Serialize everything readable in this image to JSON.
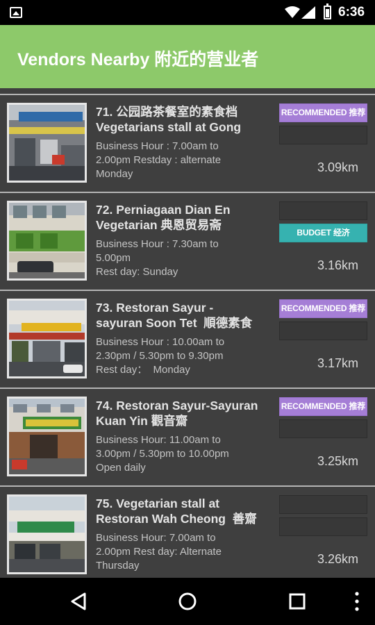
{
  "status_bar": {
    "time": "6:36"
  },
  "app_bar": {
    "title": "Vendors Nearby 附近的营业者"
  },
  "vendors": [
    {
      "name": "71. 公园路茶餐室的素食档\nVegetarians stall at Gong",
      "hours": "Business Hour : 7.00am to\n2.00pm Restday : alternate\nMonday",
      "badge1": "RECOMMENDED 推荐",
      "badge2": "",
      "distance": "3.09km"
    },
    {
      "name": "72. Perniagaan Dian En\nVegetarian 典恩贸易斋",
      "hours": "Business Hour : 7.30am to\n5.00pm\nRest day: Sunday",
      "badge1": "",
      "badge2": "BUDGET 经济",
      "distance": "3.16km"
    },
    {
      "name": "73. Restoran Sayur -\nsayuran Soon Tet  順德素食",
      "hours": "Business Hour : 10.00am to\n2.30pm / 5.30pm to 9.30pm\nRest day：  Monday",
      "badge1": "RECOMMENDED 推荐",
      "badge2": "",
      "distance": "3.17km"
    },
    {
      "name": "74. Restoran Sayur-Sayuran\nKuan Yin 觀音齋",
      "hours": "Business Hour: 11.00am to\n3.00pm / 5.30pm to 10.00pm\nOpen daily",
      "badge1": "RECOMMENDED 推荐",
      "badge2": "",
      "distance": "3.25km"
    },
    {
      "name": "75. Vegetarian stall at\nRestoran Wah Cheong  善齋",
      "hours": "Business Hour: 7.00am to\n2.00pm Rest day: Alternate\nThursday",
      "badge1": "",
      "badge2": "",
      "distance": "3.26km"
    }
  ],
  "colors": {
    "app_bar": "#8dc96a",
    "list_bg": "#3f3f3f",
    "recommended": "#a57ed6",
    "budget": "#36b2b0"
  },
  "nav_bar": {
    "icons": [
      "back-icon",
      "home-icon",
      "recents-icon",
      "overflow-menu-icon"
    ]
  }
}
